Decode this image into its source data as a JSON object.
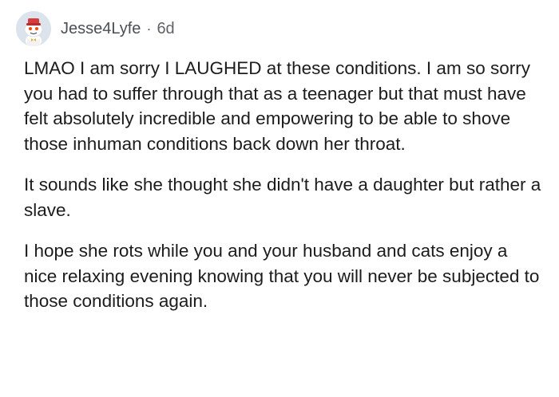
{
  "comment": {
    "author": "Jesse4Lyfe",
    "separator": "·",
    "age": "6d",
    "avatar_icon": "reddit-snoo-avatar-icon",
    "paragraphs": [
      "LMAO I am sorry I LAUGHED at these conditions. I am so sorry you had to suffer through that as a teenager but that must have felt absolutely incredible and empowering to be able to shove those inhuman conditions back down her throat.",
      "It sounds like she thought she didn't have a daughter but rather a slave.",
      "I hope she rots while you and your husband and cats enjoy a nice relaxing evening knowing that you will never be subjected to those conditions again."
    ]
  },
  "colors": {
    "background": "#ffffff",
    "text": "#1c1c1c",
    "meta_text": "#5f6368",
    "avatar_background": "#dbe4ec"
  }
}
